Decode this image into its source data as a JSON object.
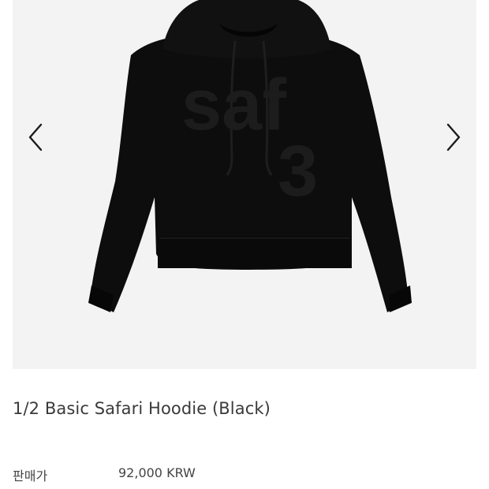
{
  "product": {
    "title": "1/2 Basic Safari Hoodie (Black)",
    "image_print_text": "saf 3",
    "image_name": "black-hoodie"
  },
  "gallery": {
    "prev_icon": "chevron-left-icon",
    "next_icon": "chevron-right-icon"
  },
  "price": {
    "label": "판매가",
    "value": "92,000 KRW"
  },
  "colors": {
    "gallery_bg": "#f3f3f3",
    "garment": "#0d0d0d",
    "text": "#3a3a3a"
  }
}
